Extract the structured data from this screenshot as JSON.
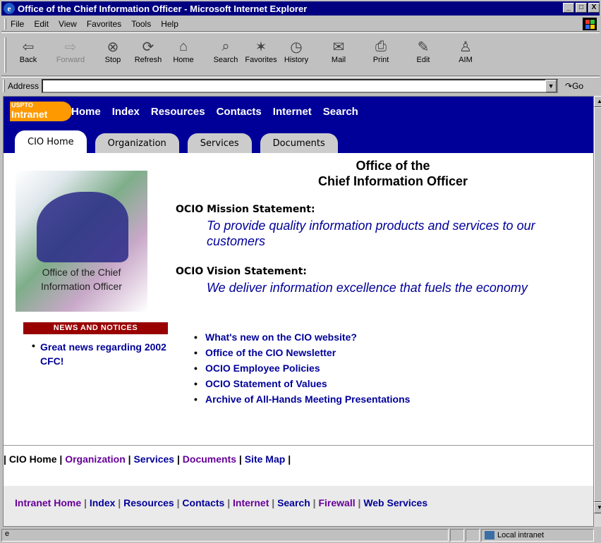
{
  "window": {
    "title": "Office of the Chief Information Officer - Microsoft Internet Explorer",
    "min": "_",
    "max": "□",
    "close": "X"
  },
  "menu": [
    "File",
    "Edit",
    "View",
    "Favorites",
    "Tools",
    "Help"
  ],
  "toolbar": [
    {
      "label": "Back",
      "icon": "back-arrow",
      "glyph": "⇦",
      "enabled": true
    },
    {
      "label": "Forward",
      "icon": "forward-arrow",
      "glyph": "⇨",
      "enabled": false
    },
    {
      "label": "Stop",
      "icon": "stop",
      "glyph": "⊗",
      "enabled": true
    },
    {
      "label": "Refresh",
      "icon": "refresh",
      "glyph": "⟳",
      "enabled": true
    },
    {
      "label": "Home",
      "icon": "home",
      "glyph": "⌂",
      "enabled": true
    },
    {
      "label": "Search",
      "icon": "search",
      "glyph": "⌕",
      "enabled": true
    },
    {
      "label": "Favorites",
      "icon": "favorites",
      "glyph": "✶",
      "enabled": true
    },
    {
      "label": "History",
      "icon": "history",
      "glyph": "◷",
      "enabled": true
    },
    {
      "label": "Mail",
      "icon": "mail",
      "glyph": "✉",
      "enabled": true
    },
    {
      "label": "Print",
      "icon": "print",
      "glyph": "⎙",
      "enabled": true
    },
    {
      "label": "Edit",
      "icon": "edit",
      "glyph": "✎",
      "enabled": true
    },
    {
      "label": "AIM",
      "icon": "aim",
      "glyph": "♙",
      "enabled": true
    }
  ],
  "address": {
    "label": "Address",
    "value": "",
    "go": "Go"
  },
  "site": {
    "logo_top": "USPTO",
    "logo_main": "Intranet",
    "nav": [
      "Home",
      "Index",
      "Resources",
      "Contacts",
      "Internet",
      "Search"
    ],
    "tabs": [
      "CIO Home",
      "Organization",
      "Services",
      "Documents"
    ],
    "image_caption_1": "Office of the Chief",
    "image_caption_2": "Information Officer",
    "heading_1": "Office of the",
    "heading_2": "Chief Information Officer",
    "mission_label": "OCIO Mission Statement:",
    "mission_text": "To provide quality information products and services to our customers",
    "vision_label": "OCIO Vision Statement:",
    "vision_text": "We deliver information excellence that fuels the economy",
    "news_header": "NEWS AND NOTICES",
    "news_items": [
      "Great news regarding 2002 CFC!"
    ],
    "links": [
      "What's new on the CIO website?",
      "Office of the CIO Newsletter",
      "OCIO Employee Policies",
      "OCIO Statement of Values",
      "Archive of All-Hands Meeting Presentations"
    ],
    "footer1": [
      "CIO Home",
      "Organization",
      "Services",
      "Documents",
      "Site Map"
    ],
    "footer2": [
      "Intranet Home",
      "Index",
      "Resources",
      "Contacts",
      "Internet",
      "Search",
      "Firewall",
      "Web Services"
    ]
  },
  "status": {
    "text": "",
    "zone": "Local intranet"
  }
}
